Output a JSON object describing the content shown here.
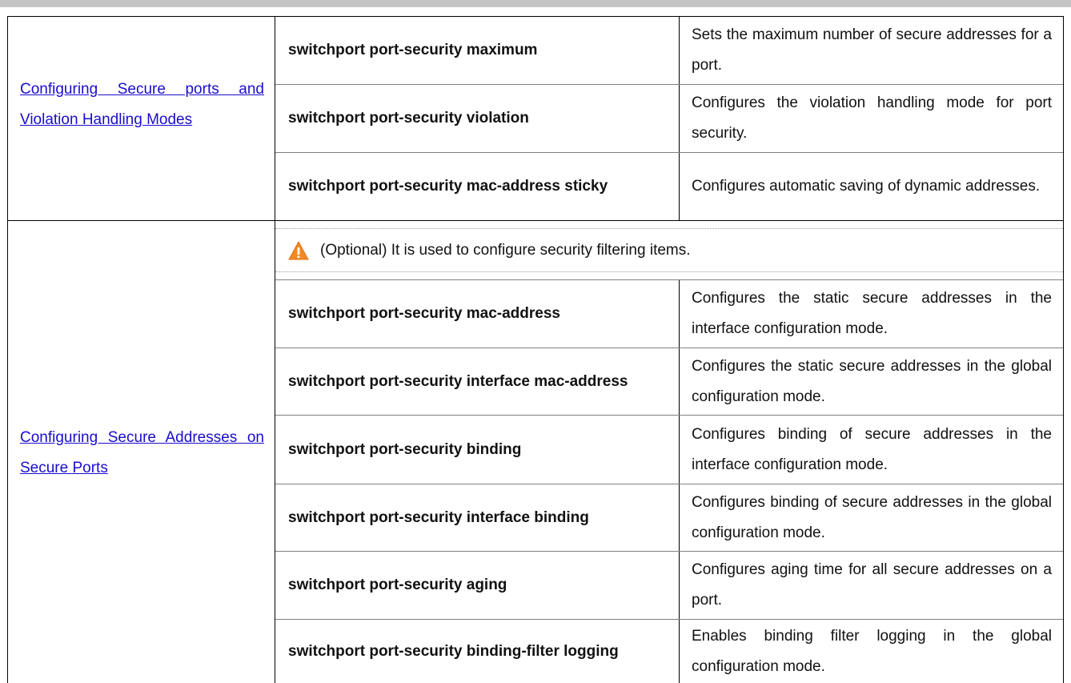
{
  "sections": [
    {
      "link": "Configuring Secure ports and Violation Handling Modes",
      "rows": [
        {
          "command": "switchport port-security maximum",
          "description": "Sets the maximum number of secure addresses for a port."
        },
        {
          "command": "switchport port-security violation",
          "description": "Configures the violation handling mode for port security."
        },
        {
          "command": "switchport port-security mac-address sticky",
          "description": "Configures automatic saving of dynamic addresses."
        }
      ]
    },
    {
      "link": "Configuring Secure Addresses on Secure Ports",
      "note": {
        "icon": "warning-icon",
        "text": "(Optional) It is used to configure security filtering items."
      },
      "rows": [
        {
          "command": "switchport port-security mac-address",
          "description": "Configures the static secure addresses in the interface configuration mode."
        },
        {
          "command": "switchport port-security interface mac-address",
          "description": "Configures the static secure addresses in the global configuration mode."
        },
        {
          "command": "switchport port-security binding",
          "description": "Configures binding of secure addresses in the interface configuration mode."
        },
        {
          "command": "switchport port-security interface binding",
          "description": "Configures binding of secure addresses in the global configuration mode."
        },
        {
          "command": "switchport port-security aging",
          "description": "Configures aging time for all secure addresses on a port."
        },
        {
          "command": "switchport port-security binding-filter logging",
          "description": "Enables binding filter logging in the global configuration mode."
        }
      ]
    }
  ],
  "colors": {
    "link": "#1a0dcc",
    "warning_fill": "#f08a24",
    "top_rule": "#c4c4c4"
  }
}
